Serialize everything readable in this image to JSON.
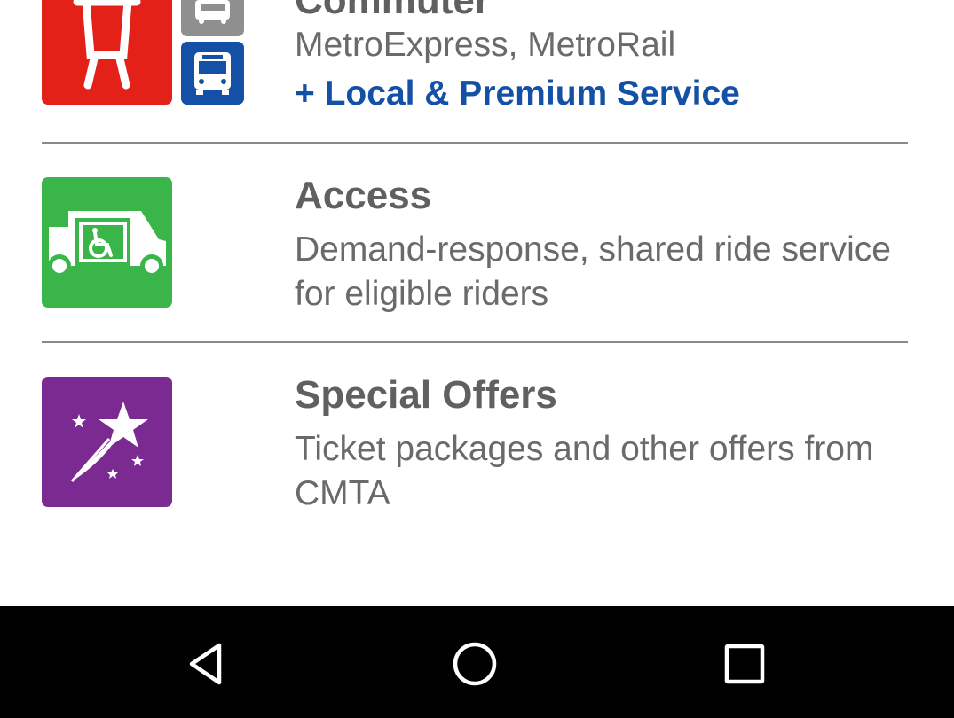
{
  "colors": {
    "commuter_red": "#e32119",
    "commuter_gray": "#8f8f8f",
    "commuter_blue": "#1451a6",
    "access_green": "#3ab54a",
    "offers_purple": "#7b2a91",
    "title_text": "#606060",
    "desc_text": "#6a6a6a",
    "link_blue": "#1451a6",
    "navbar_bg": "#000000"
  },
  "services": [
    {
      "title": "Commuter",
      "description": "MetroExpress, MetroRail",
      "extra": "+ Local & Premium Service",
      "icons": [
        "train-icon",
        "bus-icon",
        "bus-icon"
      ]
    },
    {
      "title": "Access",
      "description": "Demand-response, shared ride service for eligible riders",
      "icons": [
        "accessible-van-icon"
      ]
    },
    {
      "title": "Special Offers",
      "description": "Ticket packages and other offers from CMTA",
      "icons": [
        "shooting-star-icon"
      ]
    }
  ],
  "navbar": {
    "buttons": [
      "back-icon",
      "home-icon",
      "recents-icon"
    ]
  }
}
